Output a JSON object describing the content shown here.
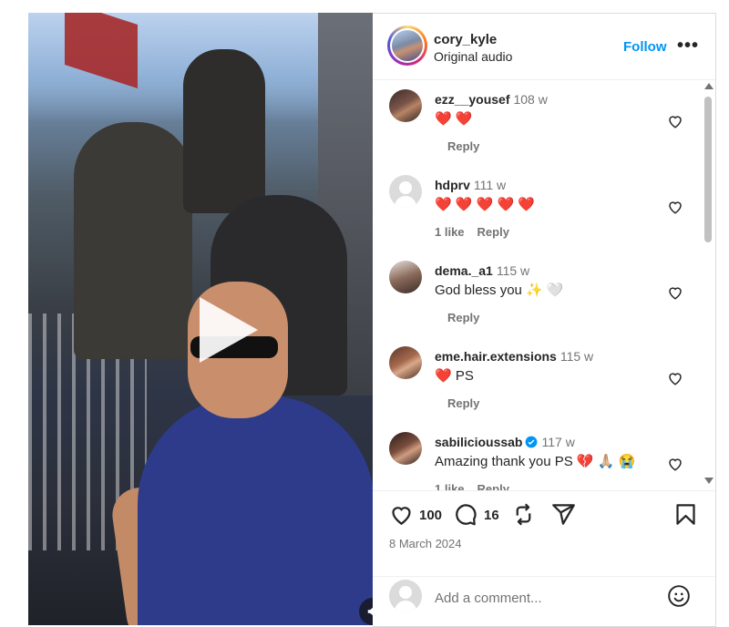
{
  "post": {
    "username": "cory_kyle",
    "audio": "Original audio",
    "follow_label": "Follow",
    "more_label": "•••"
  },
  "comments": [
    {
      "user": "ezz__yousef",
      "time": "108 w",
      "text": "❤️ ❤️",
      "likes": "",
      "reply": "Reply",
      "avatar": "photo"
    },
    {
      "user": "hdprv",
      "time": "111 w",
      "text": "❤️ ❤️ ❤️ ❤️ ❤️",
      "likes": "1 like",
      "reply": "Reply",
      "avatar": "default"
    },
    {
      "user": "dema._a1",
      "time": "115 w",
      "text": "God bless you ✨ 🤍",
      "likes": "",
      "reply": "Reply",
      "avatar": "photo"
    },
    {
      "user": "eme.hair.extensions",
      "time": "115 w",
      "text": "❤️ PS",
      "likes": "",
      "reply": "Reply",
      "avatar": "photo"
    },
    {
      "user": "sabilicioussab",
      "time": "117 w",
      "text": "Amazing thank you PS 💔 🙏🏼 😭",
      "likes": "1 like",
      "reply": "Reply",
      "verified": true,
      "avatar": "photo"
    }
  ],
  "stats": {
    "likes": "100",
    "comments": "16",
    "date": "8 March 2024"
  },
  "composer": {
    "placeholder": "Add a comment..."
  },
  "icons": {
    "video": [
      "play-icon",
      "volume-icon"
    ],
    "header": [
      "more-options-icon"
    ],
    "comment": [
      "heart-outline-icon",
      "verified-badge-icon"
    ],
    "actions": [
      "like-icon",
      "comment-icon",
      "repost-icon",
      "share-icon",
      "save-bookmark-icon"
    ],
    "composer": [
      "emoji-icon"
    ]
  },
  "colors": {
    "link": "#0095f6",
    "text": "#262626",
    "secondary": "#737373",
    "verified": "#0095f6",
    "border": "#dbdbdb"
  }
}
